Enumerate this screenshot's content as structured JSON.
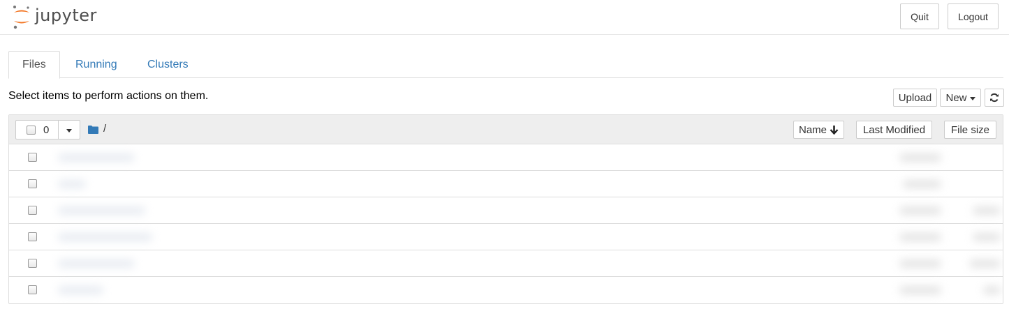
{
  "header": {
    "logo_text": "jupyter",
    "quit_label": "Quit",
    "logout_label": "Logout"
  },
  "tabs": [
    {
      "label": "Files",
      "active": true
    },
    {
      "label": "Running",
      "active": false
    },
    {
      "label": "Clusters",
      "active": false
    }
  ],
  "instructions": "Select items to perform actions on them.",
  "toolbar": {
    "upload_label": "Upload",
    "new_label": "New",
    "refresh_icon": "refresh-icon"
  },
  "list_header": {
    "selected_count": "0",
    "breadcrumb_icon": "folder-icon",
    "breadcrumb_sep": "/",
    "sort_name_label": "Name",
    "sort_icon": "arrow-down-icon",
    "last_modified_label": "Last Modified",
    "file_size_label": "File size"
  },
  "rows_note": "blurred",
  "colors": {
    "link": "#337ab7",
    "logo_orange": "#f37726",
    "logo_text": "#4e4e4e",
    "header_bg": "#eeeeee",
    "border": "#dddddd"
  }
}
